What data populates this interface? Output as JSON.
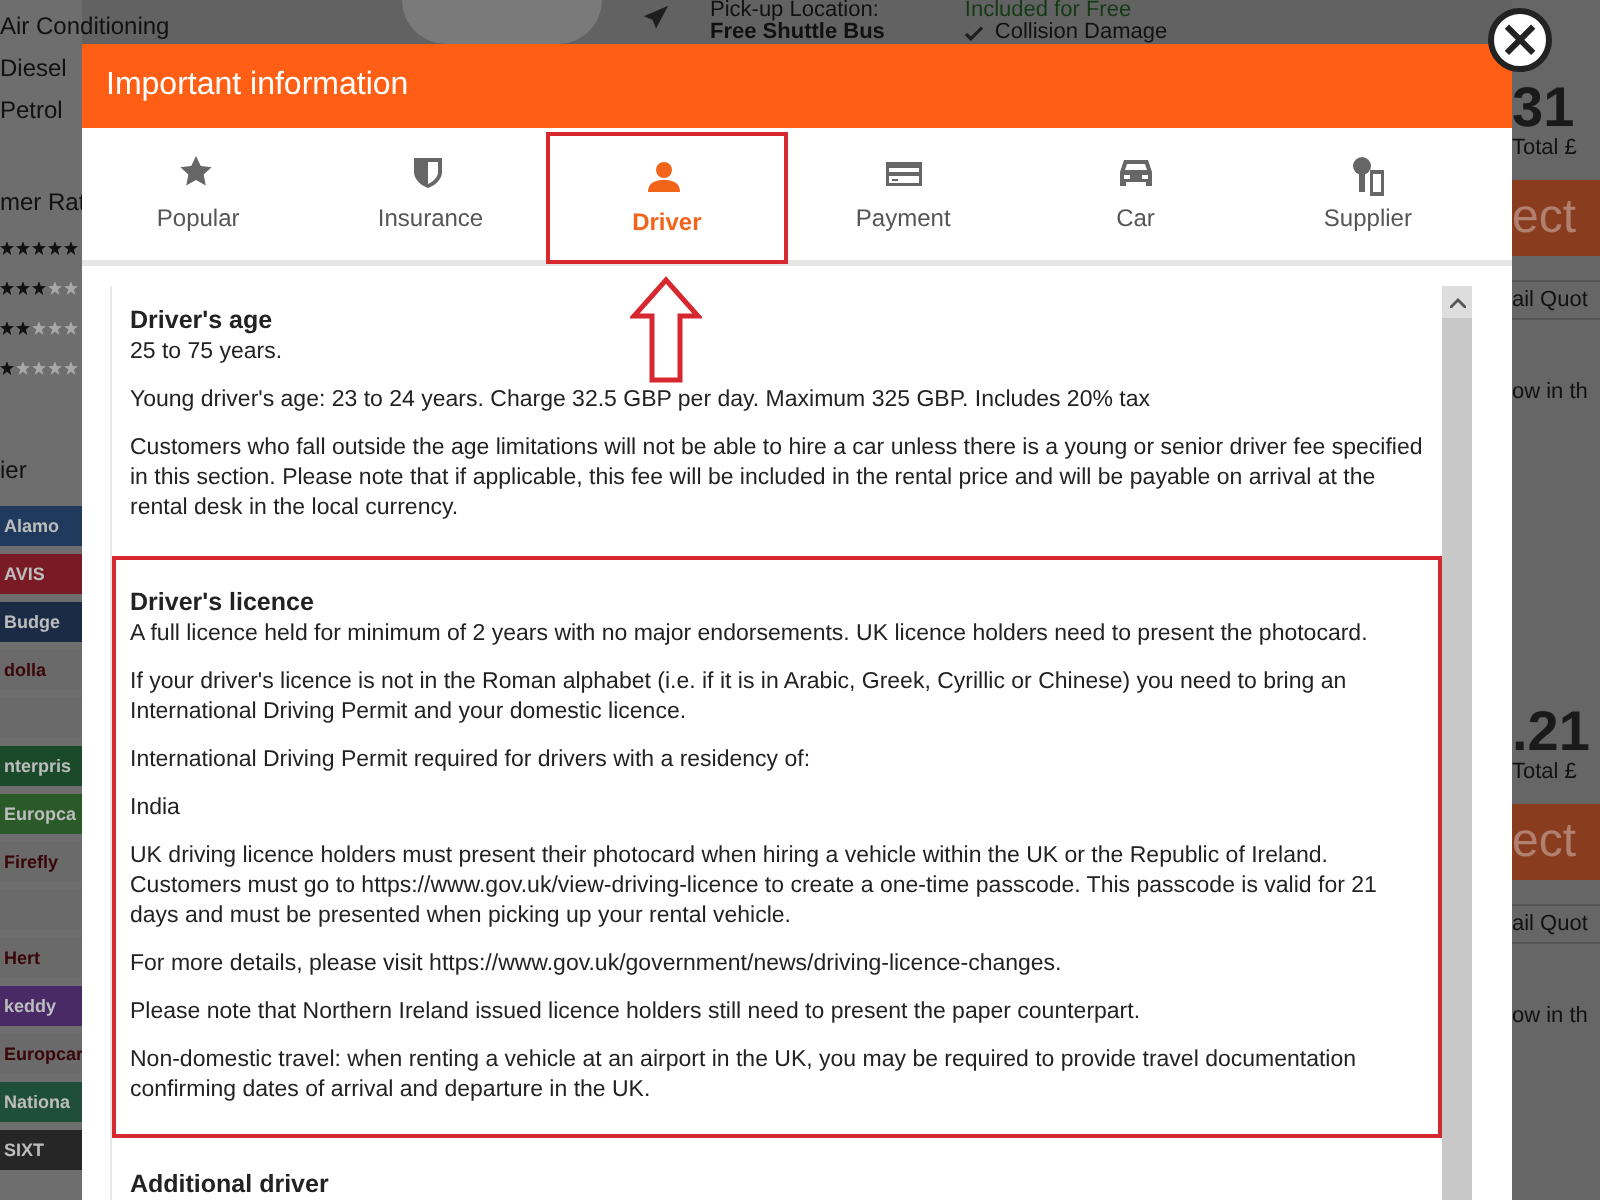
{
  "background": {
    "filters": [
      "Air Conditioning",
      "Diesel",
      "Petrol"
    ],
    "rating_heading": "mer Rat",
    "rating_rows": [
      {
        "stars": 5
      },
      {
        "stars": 3
      },
      {
        "stars": 2
      },
      {
        "stars": 1
      }
    ],
    "supplier_heading": "ier",
    "suppliers": [
      {
        "label": "Alamo",
        "color": "#1f3a5c"
      },
      {
        "label": "AVIS",
        "color": "#7a1a24"
      },
      {
        "label": "Budge",
        "color": "#1c2b45"
      },
      {
        "label": "dolla",
        "color": "#6a6a6a"
      },
      {
        "color": "#6a6a6a"
      },
      {
        "label": "nterpris",
        "color": "#1b4a2a"
      },
      {
        "label": "Europca",
        "color": "#2a5a28"
      },
      {
        "label": "Firefly",
        "color": "#6a6a6a"
      },
      {
        "color": "#6a6a6a"
      },
      {
        "label": "Hert",
        "color": "#6a6a6a"
      },
      {
        "label": "keddy",
        "color": "#4a2a66"
      },
      {
        "label": "Europcar",
        "color": "#6a6a6a"
      },
      {
        "label": "Nationa",
        "color": "#1f4f3a"
      },
      {
        "label": "SIXT",
        "color": "#262626"
      }
    ],
    "pickup_label": "Pick-up Location:",
    "pickup_value": "Free Shuttle Bus",
    "included_label": "Included for Free",
    "included_item": "Collision Damage",
    "offers": [
      {
        "price": "31",
        "total": "Total £",
        "button": "ect",
        "quote": "ail Quot",
        "note": "ow in th"
      },
      {
        "price": ".21",
        "total": "Total £",
        "button": "ect",
        "quote": "ail Quot",
        "note": "ow in th"
      }
    ]
  },
  "dialog": {
    "title": "Important information",
    "close": "×",
    "tabs": [
      {
        "label": "Popular",
        "selected": false,
        "highlighted": false
      },
      {
        "label": "Insurance",
        "selected": false,
        "highlighted": false
      },
      {
        "label": "Driver",
        "selected": true,
        "highlighted": true
      },
      {
        "label": "Payment",
        "selected": false,
        "highlighted": false
      },
      {
        "label": "Car",
        "selected": false,
        "highlighted": false
      },
      {
        "label": "Supplier",
        "selected": false,
        "highlighted": false
      }
    ],
    "sections": [
      {
        "title": "Driver's age",
        "highlighted": false,
        "paragraphs": [
          "25 to 75 years.",
          "Young driver's age: 23 to 24 years. Charge 32.5 GBP per day. Maximum 325 GBP. Includes 20% tax",
          "Customers who fall outside the age limitations will not be able to hire a car unless there is a young or senior driver fee specified in this section. Please note that if applicable, this fee will be included in the rental price and will be payable on arrival at the rental desk in the local currency."
        ]
      },
      {
        "title": "Driver's licence",
        "highlighted": true,
        "paragraphs": [
          "A full licence held for minimum of 2 years with no major endorsements. UK licence holders need to present the photocard.",
          "If your driver's licence is not in the Roman alphabet (i.e. if it is in Arabic, Greek, Cyrillic or Chinese) you need to bring an International Driving Permit and your domestic licence.",
          "International Driving Permit required for drivers with a residency of:",
          "India",
          "UK driving licence holders must present their photocard when hiring a vehicle within the UK or the Republic of Ireland. Customers must go to https://www.gov.uk/view-driving-licence to create a one-time passcode. This passcode is valid for 21 days and must be presented when picking up your rental vehicle.",
          "For more details, please visit https://www.gov.uk/government/news/driving-licence-changes.",
          "Please note that Northern Ireland issued licence holders still need to present the paper counterpart.",
          "Non-domestic travel: when renting a vehicle at an airport in the UK, you may be required to provide travel documentation confirming dates of arrival and departure in the UK."
        ]
      },
      {
        "title": "Additional driver",
        "highlighted": false
      }
    ]
  }
}
